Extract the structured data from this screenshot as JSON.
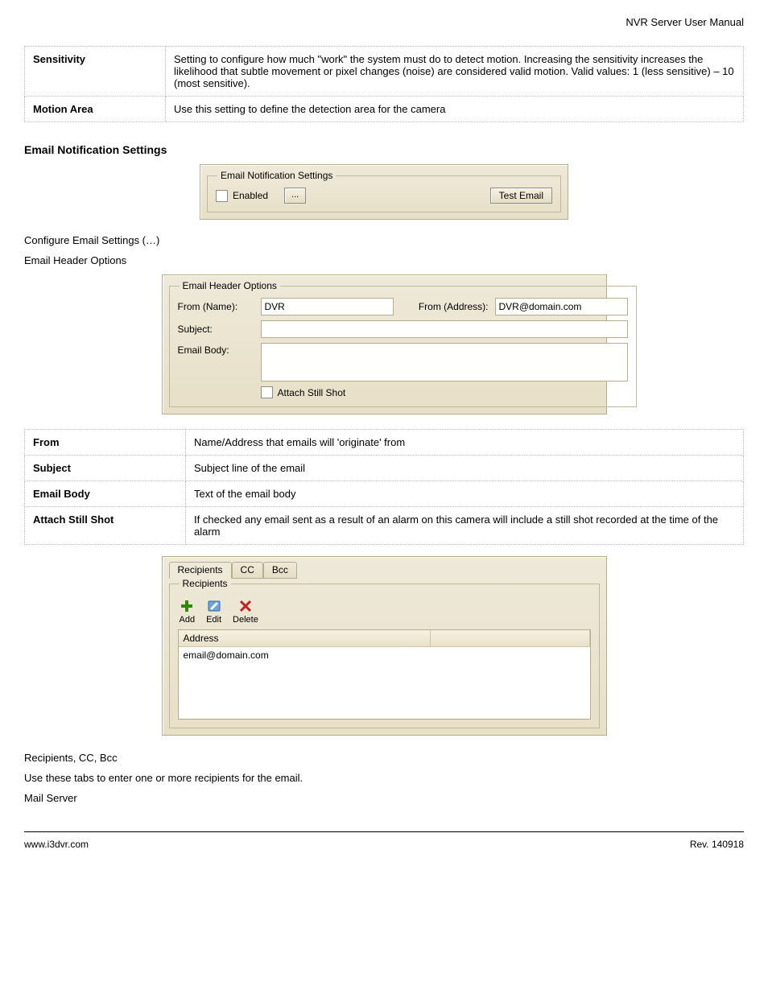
{
  "doc_title": "NVR Server User Manual",
  "table1": {
    "rows": [
      {
        "label": "Sensitivity",
        "desc": "Setting to configure how much \"work\" the system must do to detect motion. Increasing the sensitivity increases the likelihood that subtle movement or pixel changes (noise) are considered valid motion. Valid values: 1 (less sensitive) – 10 (most sensitive)."
      },
      {
        "label": "Motion Area",
        "desc": "Use this setting to define the detection area for the camera"
      }
    ]
  },
  "sec_email_notify": "Email Notification Settings",
  "email_notify_fs": {
    "legend": "Email Notification Settings",
    "enabled_label": "Enabled",
    "config_btn": "...",
    "test_btn": "Test Email"
  },
  "sub_config_title": "Configure Email Settings (…)",
  "sub_header_options": "Email Header Options",
  "header_fs": {
    "legend": "Email Header Options",
    "from_name_label": "From (Name):",
    "from_name_value": "DVR",
    "from_addr_label": "From (Address):",
    "from_addr_value": "DVR@domain.com",
    "subject_label": "Subject:",
    "subject_value": "",
    "body_label": "Email Body:",
    "body_value": "",
    "attach_label": "Attach Still Shot"
  },
  "table2": {
    "rows": [
      {
        "label": "From",
        "desc": "Name/Address that emails will 'originate' from"
      },
      {
        "label": "Subject",
        "desc": "Subject line of the email"
      },
      {
        "label": "Email Body",
        "desc": "Text of the email body"
      },
      {
        "label": "Attach Still Shot",
        "desc": "If checked any email sent as a result of an alarm on this camera will include a still shot recorded at the time of the alarm"
      }
    ]
  },
  "recipients_fs": {
    "tabs": [
      "Recipients",
      "CC",
      "Bcc"
    ],
    "legend": "Recipients",
    "tools": {
      "add": "Add",
      "edit": "Edit",
      "delete": "Delete"
    },
    "col_header": "Address",
    "sample_row": "email@domain.com"
  },
  "recipients_heading": "Recipients, CC, Bcc",
  "recipients_desc": "Use these tabs to enter one or more recipients for the email.",
  "mail_server_heading": "Mail Server",
  "footer": {
    "left": "www.i3dvr.com",
    "right": "Rev. 140918"
  }
}
